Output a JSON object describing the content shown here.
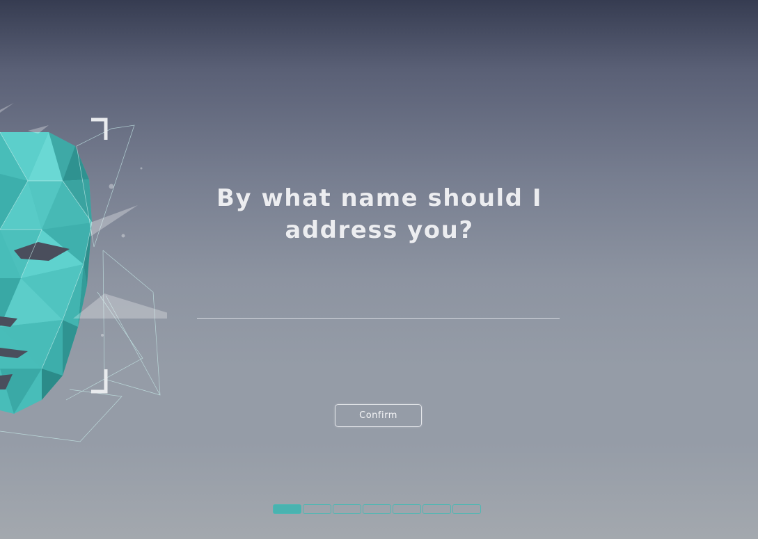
{
  "prompt": {
    "question": "By what name should I address you?"
  },
  "name_input": {
    "value": "",
    "placeholder": ""
  },
  "actions": {
    "confirm_label": "Confirm"
  },
  "progress": {
    "total_steps": 7,
    "current_step": 1
  },
  "colors": {
    "accent": "#49b3b0",
    "face_light": "#62d0cc",
    "face_dark": "#2a8f8f",
    "background_top": "#363c51",
    "background_bottom": "#a3a8ae"
  },
  "decor": {
    "illustration": "low-poly-face-icon"
  }
}
